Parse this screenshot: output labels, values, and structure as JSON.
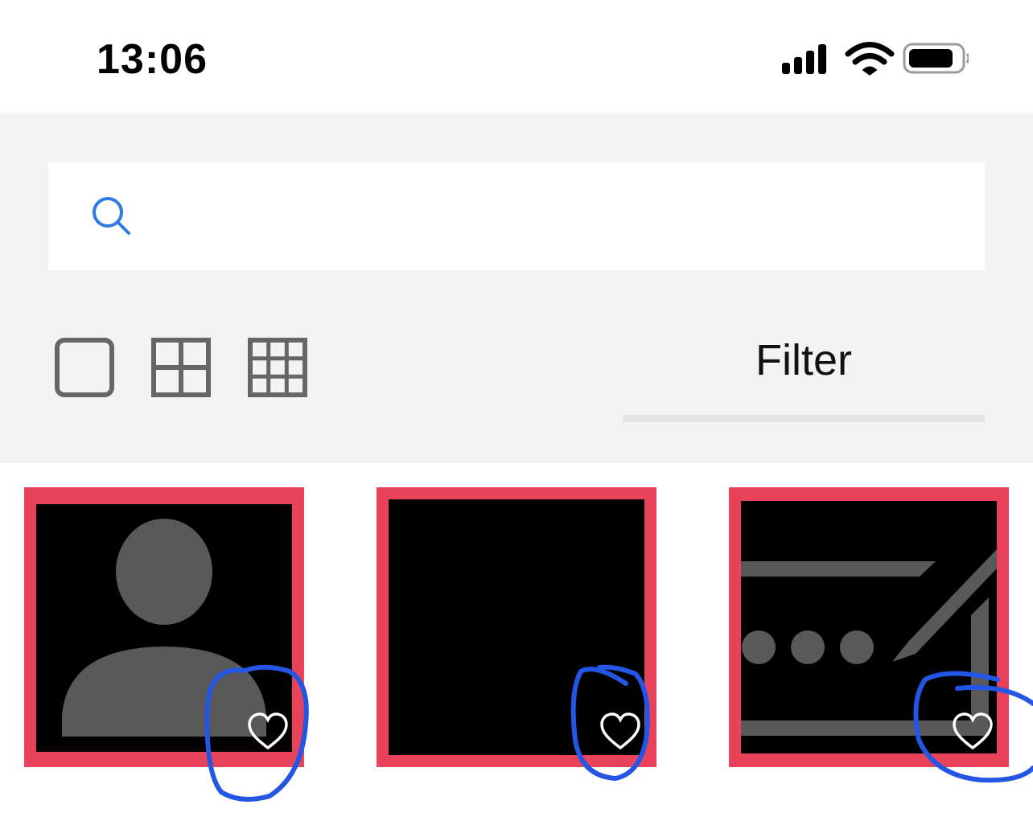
{
  "status_bar": {
    "time": "13:06",
    "icons": [
      "cellular-signal-icon",
      "wifi-icon",
      "battery-icon"
    ]
  },
  "search": {
    "value": "",
    "placeholder": "",
    "icon": "search-icon"
  },
  "view_options": [
    {
      "name": "single-view",
      "icon": "single-square-icon"
    },
    {
      "name": "grid-2x2-view",
      "icon": "grid-2x2-icon"
    },
    {
      "name": "grid-3x3-view",
      "icon": "grid-3x3-icon"
    }
  ],
  "filter": {
    "label": "Filter"
  },
  "tiles": [
    {
      "thumbnail_icon": "person-placeholder-icon",
      "favorite_icon": "heart-icon"
    },
    {
      "thumbnail_icon": "blank",
      "favorite_icon": "heart-icon"
    },
    {
      "thumbnail_icon": "password-field-edit-icon",
      "favorite_icon": "heart-icon"
    }
  ],
  "colors": {
    "toolbar_bg": "#f3f3f3",
    "tile_border": "#e8435a",
    "search_icon": "#2f7be5",
    "annotation_stroke": "#2456e6",
    "icon_gray": "#666666"
  }
}
